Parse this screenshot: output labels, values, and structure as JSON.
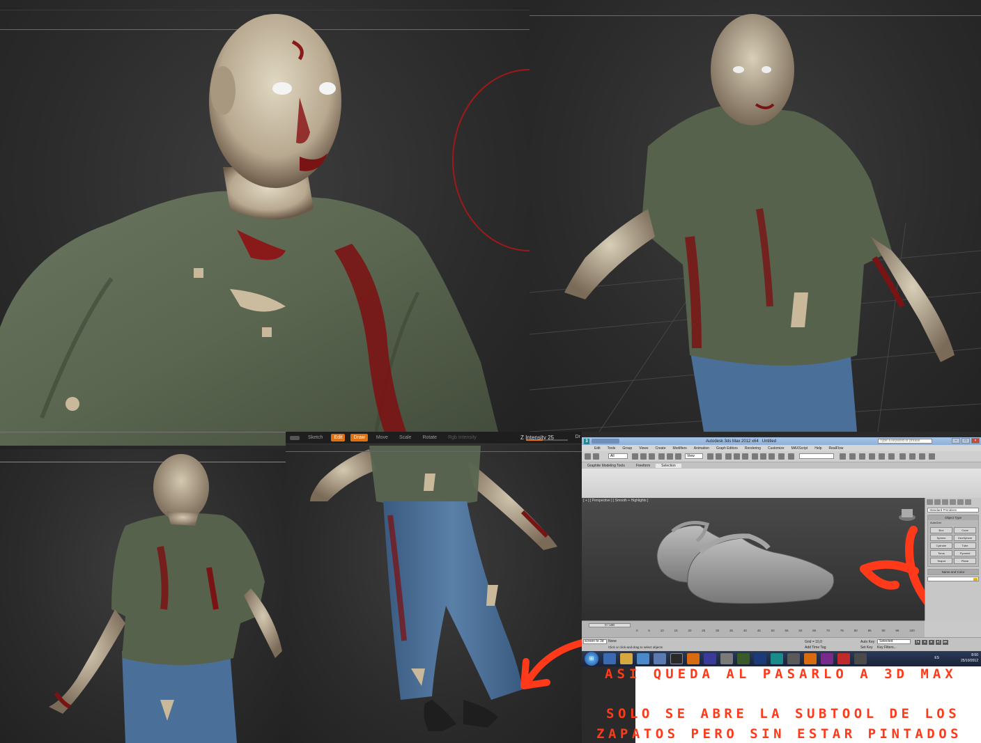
{
  "zbrush_toolbar": {
    "sketch_label": "Sketch",
    "edit_label": "Edit",
    "draw_label": "Draw",
    "move_label": "Move",
    "scale_label": "Scale",
    "rotate_label": "Rotate",
    "rgb_intensity_label": "Rgb Intensity",
    "z_intensity_label": "Z Intensity 25",
    "z_intensity_level": 25,
    "overflow_label": "Dr"
  },
  "max_window": {
    "title": "Autodesk 3ds Max 2012 x64",
    "doc_title": "Untitled",
    "search_placeholder": "Type a keyword or phrase",
    "menu": [
      "Edit",
      "Tools",
      "Group",
      "Views",
      "Create",
      "Modifiers",
      "Animation",
      "Graph Editors",
      "Rendering",
      "Customize",
      "MAXScript",
      "Help",
      "RealFlow"
    ],
    "selection_filter": "All",
    "view_dropdown": "View",
    "ribbon_tabs": [
      "Graphite Modeling Tools",
      "Freeform",
      "Selection"
    ],
    "viewport_label": "[ + ] [ Perspective ] [ Smooth + Highlights ]",
    "command_panel": {
      "category": "Standard Primitives",
      "object_type_header": "Object Type",
      "autogrid_label": "AutoGrid",
      "buttons": [
        "Box",
        "Cone",
        "Sphere",
        "GeoSphere",
        "Cylinder",
        "Tube",
        "Torus",
        "Pyramid",
        "Teapot",
        "Plane"
      ],
      "name_color_header": "Name and Color"
    },
    "timeline": {
      "slider_label": "0 / 100",
      "ticks": [
        "0",
        "5",
        "10",
        "15",
        "20",
        "25",
        "30",
        "35",
        "40",
        "45",
        "50",
        "55",
        "60",
        "65",
        "70",
        "75",
        "80",
        "85",
        "90",
        "95",
        "100"
      ]
    },
    "status": {
      "maxscript_text": "screen to 3d",
      "hint": "Click or click-and-drag to select objects",
      "grid": "Grid = 10,0",
      "auto_key": "Auto Key",
      "auto_key_value": "Selected",
      "set_key": "Set Key",
      "key_filters": "Key Filters...",
      "add_time_tag": "Add Time Tag",
      "new_label": "None"
    }
  },
  "taskbar": {
    "language": "ES",
    "time": "8:50",
    "date": "25/10/2012"
  },
  "captions": {
    "line1": "ASI QUEDA AL PASARLO A 3D MAX",
    "line2": "SOLO SE ABRE LA SUBTOOL DE LOS",
    "line3": "ZAPATOS PERO SIN ESTAR PINTADOS"
  },
  "colors": {
    "arrow": "#ff3a1a",
    "zbrush_accent": "#e07010",
    "viewport_bg": "#2e2e2e",
    "shirt": "#5a6650",
    "skin": "#c8bfa8",
    "blood": "#8a1a1a",
    "jeans": "#4a6f98"
  }
}
